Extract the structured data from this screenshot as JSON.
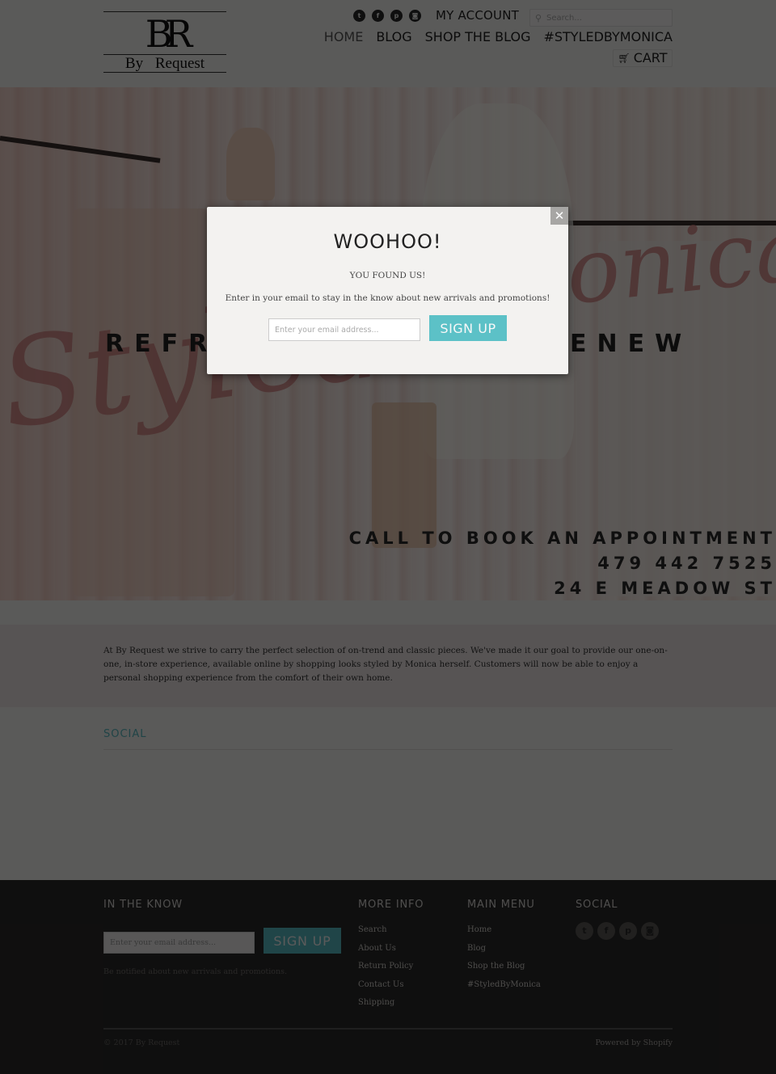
{
  "header": {
    "logo_monogram": "BR",
    "logo_name": "By Request",
    "social_icons": [
      {
        "name": "twitter-icon",
        "glyph": "t"
      },
      {
        "name": "facebook-icon",
        "glyph": "f"
      },
      {
        "name": "pinterest-icon",
        "glyph": "p"
      },
      {
        "name": "instagram-icon",
        "glyph": "◙"
      }
    ],
    "my_account": "MY ACCOUNT",
    "search_placeholder": "Search...",
    "search_icon": "⚲",
    "nav": [
      {
        "label": "HOME",
        "active": true
      },
      {
        "label": "BLOG"
      },
      {
        "label": "SHOP THE BLOG"
      },
      {
        "label": "#STYLEDBYMONICA"
      }
    ],
    "cart_label": "CART",
    "cart_icon": "🛒"
  },
  "hero": {
    "script_text": "Styled by Monica",
    "script_left": "Styled",
    "script_right": "onica",
    "tagline_left": "REFR",
    "tagline_right": "ENEW",
    "call_line": "CALL TO BOOK AN APPOINTMENT",
    "phone": "479 442 7525",
    "address": "24 E MEADOW ST"
  },
  "about": {
    "text": "At By Request we strive to carry the perfect selection of on-trend and classic pieces. We've made it our goal to provide our one-on-one, in-store experience, available online by shopping looks styled by Monica herself. Customers will now be able to enjoy a personal shopping experience from the comfort of their own home."
  },
  "social_section": {
    "title": "SOCIAL"
  },
  "footer": {
    "newsletter": {
      "title": "IN THE KNOW",
      "placeholder": "Enter your email address...",
      "button": "SIGN UP",
      "note": "Be notified about new arrivals and promotions."
    },
    "more_info": {
      "title": "MORE INFO",
      "links": [
        "Search",
        "About Us",
        "Return Policy",
        "Contact Us",
        "Shipping"
      ]
    },
    "main_menu": {
      "title": "MAIN MENU",
      "links": [
        "Home",
        "Blog",
        "Shop the Blog",
        "#StyledByMonica"
      ]
    },
    "social": {
      "title": "SOCIAL",
      "icons": [
        {
          "name": "twitter-icon",
          "glyph": "t"
        },
        {
          "name": "facebook-icon",
          "glyph": "f"
        },
        {
          "name": "pinterest-icon",
          "glyph": "p"
        },
        {
          "name": "instagram-icon",
          "glyph": "◙"
        }
      ]
    },
    "copyright": "© 2017 By Request",
    "powered": "Powered by Shopify"
  },
  "modal": {
    "close_glyph": "✕",
    "title": "WOOHOO!",
    "subtitle": "YOU FOUND US!",
    "description": "Enter in your email to stay in the know about new arrivals and promotions!",
    "email_placeholder": "Enter your email address...",
    "button": "SIGN UP"
  },
  "colors": {
    "accent": "#5cc1c7",
    "overlay": "rgba(0,0,0,0.63)",
    "footer_bg": "#2b2a2a"
  }
}
